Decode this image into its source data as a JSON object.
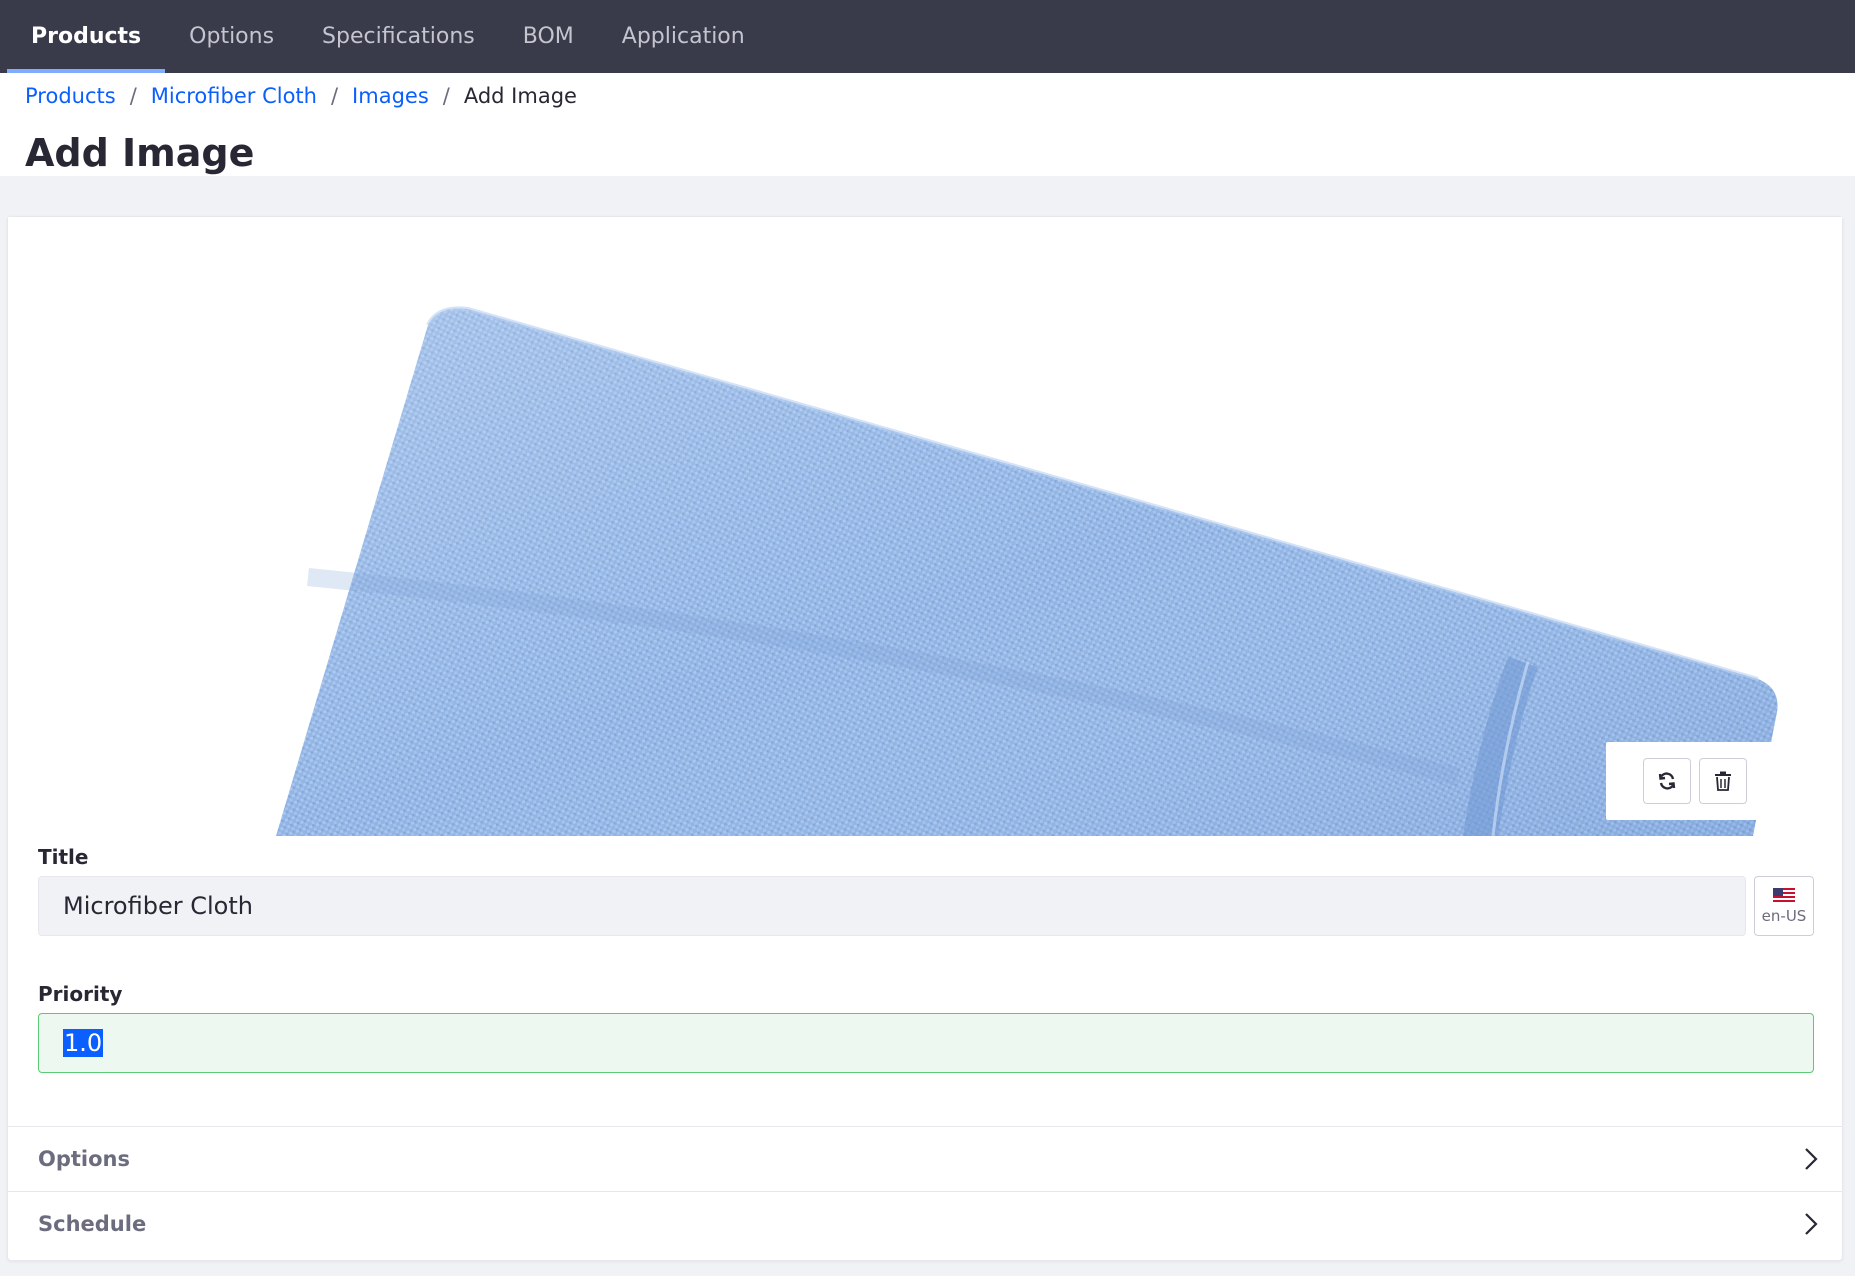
{
  "nav": {
    "tabs": [
      {
        "label": "Products",
        "active": true
      },
      {
        "label": "Options",
        "active": false
      },
      {
        "label": "Specifications",
        "active": false
      },
      {
        "label": "BOM",
        "active": false
      },
      {
        "label": "Application",
        "active": false
      }
    ]
  },
  "breadcrumb": {
    "items": [
      "Products",
      "Microfiber Cloth",
      "Images"
    ],
    "current": "Add Image",
    "separator": "/"
  },
  "page": {
    "title": "Add Image"
  },
  "image": {
    "subject": "blue microfiber cloth",
    "actions": {
      "refresh_icon": "refresh-icon",
      "delete_icon": "trash-icon"
    }
  },
  "form": {
    "title_label": "Title",
    "title_value": "Microfiber Cloth",
    "lang_code": "en-US",
    "priority_label": "Priority",
    "priority_value": "1.0"
  },
  "panels": [
    {
      "label": "Options"
    },
    {
      "label": "Schedule"
    }
  ],
  "colors": {
    "nav_bg": "#393a4a",
    "accent": "#0b5fff",
    "success_border": "#5aca75",
    "cloth_blue": "#8fb3e3"
  }
}
